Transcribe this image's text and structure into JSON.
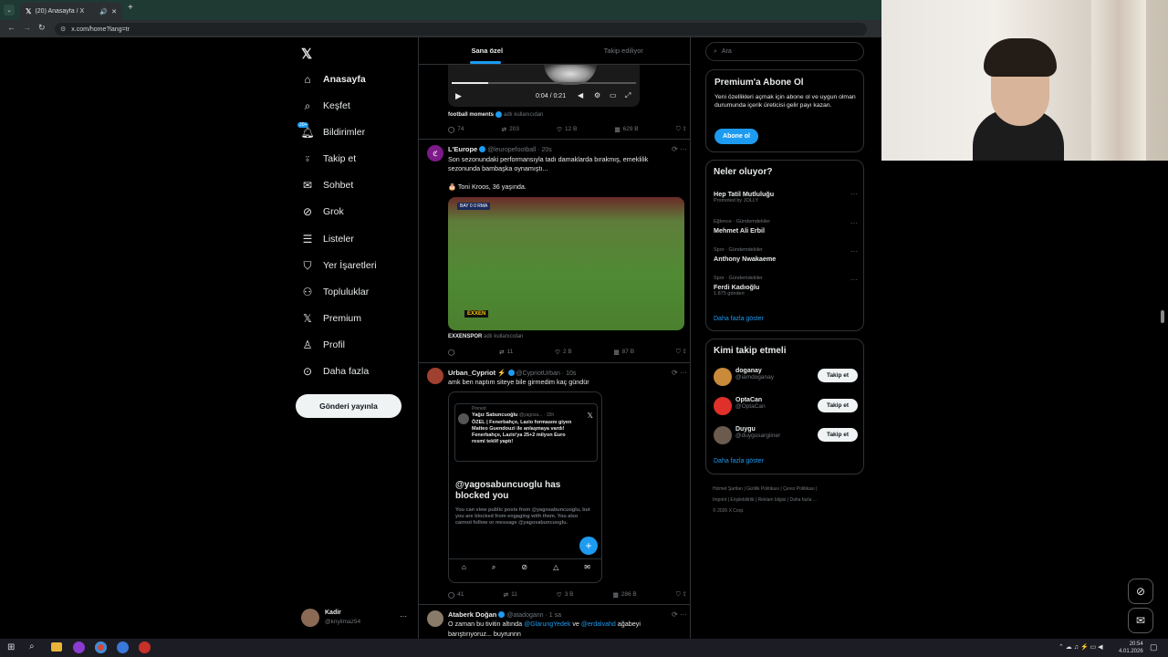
{
  "browser": {
    "tab_title": "(20) Anasayfa / X",
    "url": "x.com/home?lang=tr"
  },
  "sidebar": {
    "items": [
      {
        "label": "Anasayfa",
        "icon": "home-icon"
      },
      {
        "label": "Keşfet",
        "icon": "search-icon"
      },
      {
        "label": "Bildirimler",
        "icon": "bell-icon",
        "badge": "20+"
      },
      {
        "label": "Takip et",
        "icon": "person-plus-icon"
      },
      {
        "label": "Sohbet",
        "icon": "mail-icon"
      },
      {
        "label": "Grok",
        "icon": "grok-icon"
      },
      {
        "label": "Listeler",
        "icon": "list-icon"
      },
      {
        "label": "Yer İşaretleri",
        "icon": "bookmark-icon"
      },
      {
        "label": "Topluluklar",
        "icon": "people-icon"
      },
      {
        "label": "Premium",
        "icon": "x-logo-icon"
      },
      {
        "label": "Profil",
        "icon": "person-icon"
      },
      {
        "label": "Daha fazla",
        "icon": "more-circle-icon"
      }
    ],
    "post_button": "Gönderi yayınla",
    "account": {
      "name": "Kadir",
      "handle": "@knyilmaz54"
    }
  },
  "feed": {
    "tabs": [
      "Sana özel",
      "Takip ediliyor"
    ],
    "video": {
      "time": "0:04 / 0:21"
    },
    "post0": {
      "source_name": "football moments",
      "source_suffix": "adlı kullanıcıdan",
      "replies": "74",
      "reposts": "203",
      "likes": "12 B",
      "views": "629 B"
    },
    "post1": {
      "name": "L'Europe",
      "handle": "@leuropefootball · 20s",
      "text1": "Son sezonundaki performansıyla tadı damaklarda bırakmış, emeklilik sezonunda bambaşka oynamıştı...",
      "text2": "🎂 Toni Kroos, 36 yaşında.",
      "score": "BAY 0 0 RMA",
      "broadcaster": "EXXEN",
      "source_name": "EXXENSPOR",
      "source_suffix": "adlı kullanıcıdan",
      "replies": "",
      "reposts": "11",
      "likes": "2 B",
      "views": "87 B"
    },
    "post2": {
      "name": "Urban_Cypriot ⚡",
      "handle": "@CypriotUrban · 10s",
      "text": "amk ben naptım siteye bile girmedim kaç gündür",
      "inner": {
        "pinned": "Pinned",
        "author": "Yağız Sabuncuoğlu",
        "handle": "@yagosa... · 15h",
        "text": "ÖZEL | Fenerbahçe, Lazio formasını giyen Matteo Guendouzi ile anlaşmaya vardı! Fenerbahçe, Lazio'ya 25+2 milyon Euro resmi teklif yaptı!",
        "blocked_title": "@yagosabuncuoglu has blocked you",
        "blocked_text": "You can view public posts from @yagosabuncuoglu, but you are blocked from engaging with them. You also cannot follow or message @yagosabuncuoglu."
      },
      "replies": "41",
      "reposts": "11",
      "likes": "3 B",
      "views": "286 B"
    },
    "post3": {
      "name": "Ataberk Doğan",
      "handle": "@atadogann · 1 sa",
      "text_a": "O zaman bu tivitin altında",
      "mention1": "@GlarungYedek",
      "text_b": "ve",
      "mention2": "@erdalvahd",
      "text_c": "ağabeyi barıştırıyoruz... buyrunnn"
    }
  },
  "right": {
    "search_placeholder": "Ara",
    "premium": {
      "title": "Premium'a Abone Ol",
      "text": "Yeni özellikleri açmak için abone ol ve uygun olman durumunda içerik üreticisi gelir payı kazan.",
      "button": "Abone ol"
    },
    "trends": {
      "title": "Neler oluyor?",
      "items": [
        {
          "meta": "",
          "name": "Hep Tatil Mutluluğu",
          "sub": "Promoted by JOLLY"
        },
        {
          "meta": "Eğlence · Gündemdekiler",
          "name": "Mehmet Ali Erbil",
          "sub": ""
        },
        {
          "meta": "Spor · Gündemdekiler",
          "name": "Anthony Nwakaeme",
          "sub": ""
        },
        {
          "meta": "Spor · Gündemdekiler",
          "name": "Ferdi Kadıoğlu",
          "sub": "1.875 gönderi"
        }
      ],
      "more": "Daha fazla göster"
    },
    "who_to_follow": {
      "title": "Kimi takip etmeli",
      "items": [
        {
          "name": "doganay",
          "handle": "@iamdoganay",
          "button": "Takip et",
          "color": "#c98a3a"
        },
        {
          "name": "OptaCan",
          "handle": "@OptaCan",
          "button": "Takip et",
          "color": "#e0302a"
        },
        {
          "name": "Duygu",
          "handle": "@duygusargiiner",
          "button": "Takip et",
          "color": "#6b5a4e"
        }
      ],
      "more": "Daha fazla göster"
    },
    "footer": {
      "line1": [
        "Hizmet Şartları",
        "Gizlilik Politikası",
        "Çerez Politikası"
      ],
      "line2": [
        "Imprint",
        "Erişilebilirlik",
        "Reklam bilgisi",
        "Daha fazla ..."
      ],
      "copyright": "© 2026 X Corp."
    }
  },
  "taskbar": {
    "time": "20:54",
    "date": "4.01.2026"
  },
  "colors": {
    "accent": "#1d9bf0",
    "background": "#000000",
    "border": "#2f3336",
    "muted": "#71767b"
  }
}
